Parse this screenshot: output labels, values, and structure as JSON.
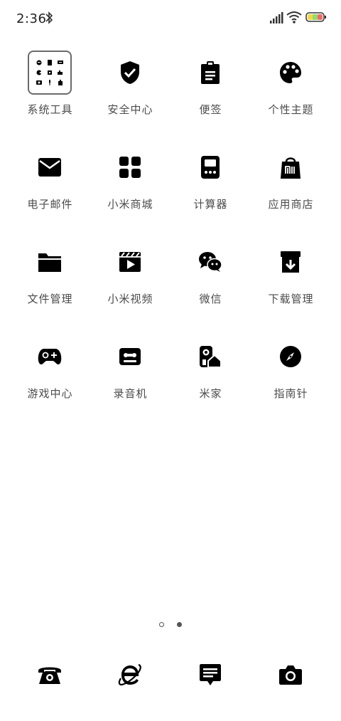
{
  "status_bar": {
    "time": "2:36"
  },
  "apps": [
    {
      "label": "系统工具",
      "icon": "folder-icon"
    },
    {
      "label": "安全中心",
      "icon": "shield-icon"
    },
    {
      "label": "便签",
      "icon": "notes-icon"
    },
    {
      "label": "个性主题",
      "icon": "palette-icon"
    },
    {
      "label": "电子邮件",
      "icon": "mail-icon"
    },
    {
      "label": "小米商城",
      "icon": "store-grid-icon"
    },
    {
      "label": "计算器",
      "icon": "calculator-icon"
    },
    {
      "label": "应用商店",
      "icon": "app-store-bag-icon"
    },
    {
      "label": "文件管理",
      "icon": "file-folder-icon"
    },
    {
      "label": "小米视频",
      "icon": "video-icon"
    },
    {
      "label": "微信",
      "icon": "wechat-icon"
    },
    {
      "label": "下载管理",
      "icon": "download-icon"
    },
    {
      "label": "游戏中心",
      "icon": "gamepad-icon"
    },
    {
      "label": "录音机",
      "icon": "recorder-icon"
    },
    {
      "label": "米家",
      "icon": "mijia-icon"
    },
    {
      "label": "指南针",
      "icon": "compass-icon"
    }
  ],
  "page_indicator": {
    "count": 2,
    "active_index": 1
  },
  "dock": [
    {
      "icon": "phone-icon"
    },
    {
      "icon": "browser-icon"
    },
    {
      "icon": "messages-icon"
    },
    {
      "icon": "camera-icon"
    }
  ]
}
